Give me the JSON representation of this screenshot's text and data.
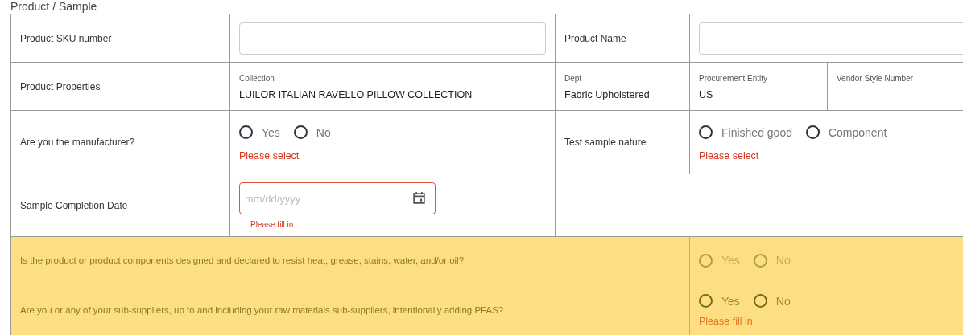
{
  "section_title": "Product / Sample",
  "sku": {
    "label": "Product SKU number"
  },
  "product_name": {
    "label": "Product Name"
  },
  "properties": {
    "label": "Product Properties",
    "fields": [
      {
        "label": "Collection",
        "value": "LUILOR ITALIAN RAVELLO PILLOW COLLECTION"
      },
      {
        "label": "Dept",
        "value": "Fabric Upholstered"
      },
      {
        "label": "Procurement Entity",
        "value": "US"
      },
      {
        "label": "Vendor Style Number"
      }
    ]
  },
  "manufacturer": {
    "label": "Are you the manufacturer?",
    "options": [
      {
        "label": "Yes",
        "selected": false
      },
      {
        "label": "No",
        "selected": false
      }
    ],
    "error": "Please select"
  },
  "sample_nature": {
    "label": "Test sample nature",
    "options": [
      {
        "label": "Finished good",
        "selected": false
      },
      {
        "label": "Component",
        "selected": false
      }
    ],
    "error": "Please select"
  },
  "completion_date": {
    "label": "Sample Completion Date",
    "placeholder": "mm/dd/yyyy",
    "invalid": true,
    "error": "Please fill in"
  },
  "compliance_questions": [
    {
      "question": "Is the product or product components designed and declared to resist heat, grease, stains, water, and/or oil?",
      "highlighted": true,
      "disabled": true,
      "options": [
        {
          "label": "Yes",
          "selected": false
        },
        {
          "label": "No",
          "selected": false
        }
      ]
    },
    {
      "question": "Are you or any of your sub-suppliers, up to and including your raw materials sub-suppliers, intentionally adding PFAS?",
      "highlighted": true,
      "disabled": false,
      "options": [
        {
          "label": "Yes",
          "selected": false
        },
        {
          "label": "No",
          "selected": false
        }
      ],
      "error": "Please fill in"
    }
  ]
}
